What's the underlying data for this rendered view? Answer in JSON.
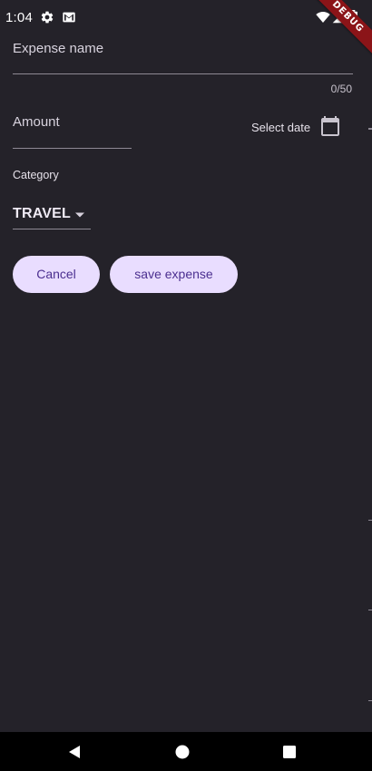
{
  "status_bar": {
    "time": "1:04",
    "icons": [
      "gear-icon",
      "gmail-icon",
      "wifi-icon",
      "signal-icon",
      "battery-icon"
    ]
  },
  "debug_banner": {
    "label": "DEBUG"
  },
  "form": {
    "expense_name": {
      "label": "Expense name",
      "value": "",
      "counter": "0/50"
    },
    "amount": {
      "label": "Amount",
      "value": ""
    },
    "date": {
      "label": "Select date",
      "icon": "calendar-icon"
    },
    "category": {
      "label": "Category",
      "selected": "TRAVEL",
      "icon": "caret-down-icon"
    },
    "actions": {
      "cancel_label": "Cancel",
      "save_label": "save expense"
    }
  },
  "navigation_bar": {
    "buttons": [
      "back-icon",
      "home-icon",
      "recents-icon"
    ]
  },
  "colors": {
    "background": "#242229",
    "pill_background": "#e9ddff",
    "pill_text": "#4b2f8f",
    "debug_banner": "#8b1418"
  }
}
